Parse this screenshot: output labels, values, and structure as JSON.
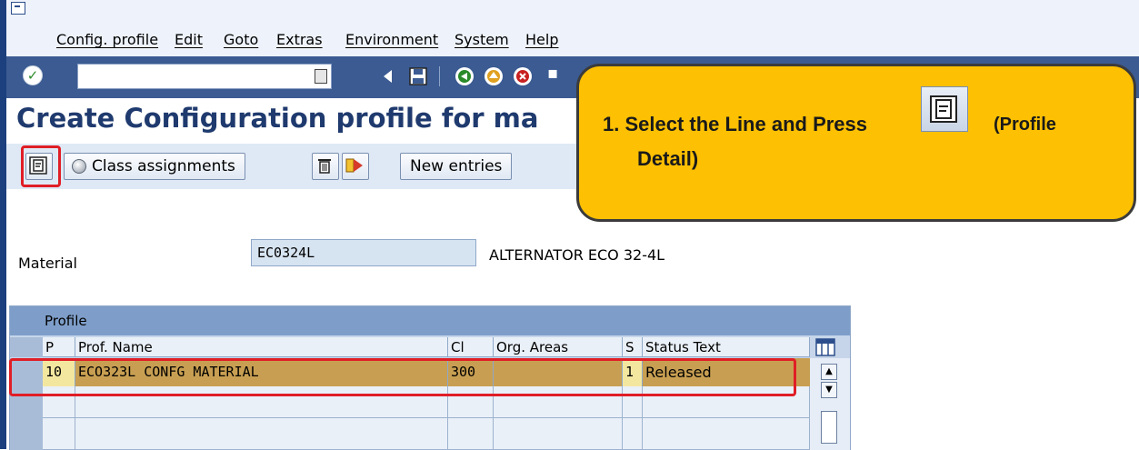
{
  "menu": [
    "Config. profile",
    "Edit",
    "Goto",
    "Extras",
    "Environment",
    "System",
    "Help"
  ],
  "page_title": "Create Configuration profile for ma",
  "app_toolbar": {
    "class_assignments": "Class assignments",
    "new_entries": "New entries"
  },
  "callout": {
    "line1": "1.  Select the Line and Press",
    "line1_suffix": "(Profile",
    "line2": "Detail)"
  },
  "material": {
    "label": "Material",
    "value": "EC0324L",
    "description": "ALTERNATOR ECO 32-4L"
  },
  "table": {
    "caption": "Profile",
    "headers": [
      "P",
      "Prof. Name",
      "Cl",
      "Org. Areas",
      "S",
      "Status Text"
    ],
    "rows": [
      {
        "p": "10",
        "prof_name": "ECO323L CONFG MATERIAL",
        "cl": "300",
        "org_areas": "",
        "s": "1",
        "status_text": "Released"
      }
    ]
  },
  "colors": {
    "callout_bg": "#fdc002",
    "highlight_box": "#e01e26",
    "selected_row": "#c89f52",
    "toolbar_bg": "#3b5b92",
    "title_color": "#1f3a6e"
  }
}
